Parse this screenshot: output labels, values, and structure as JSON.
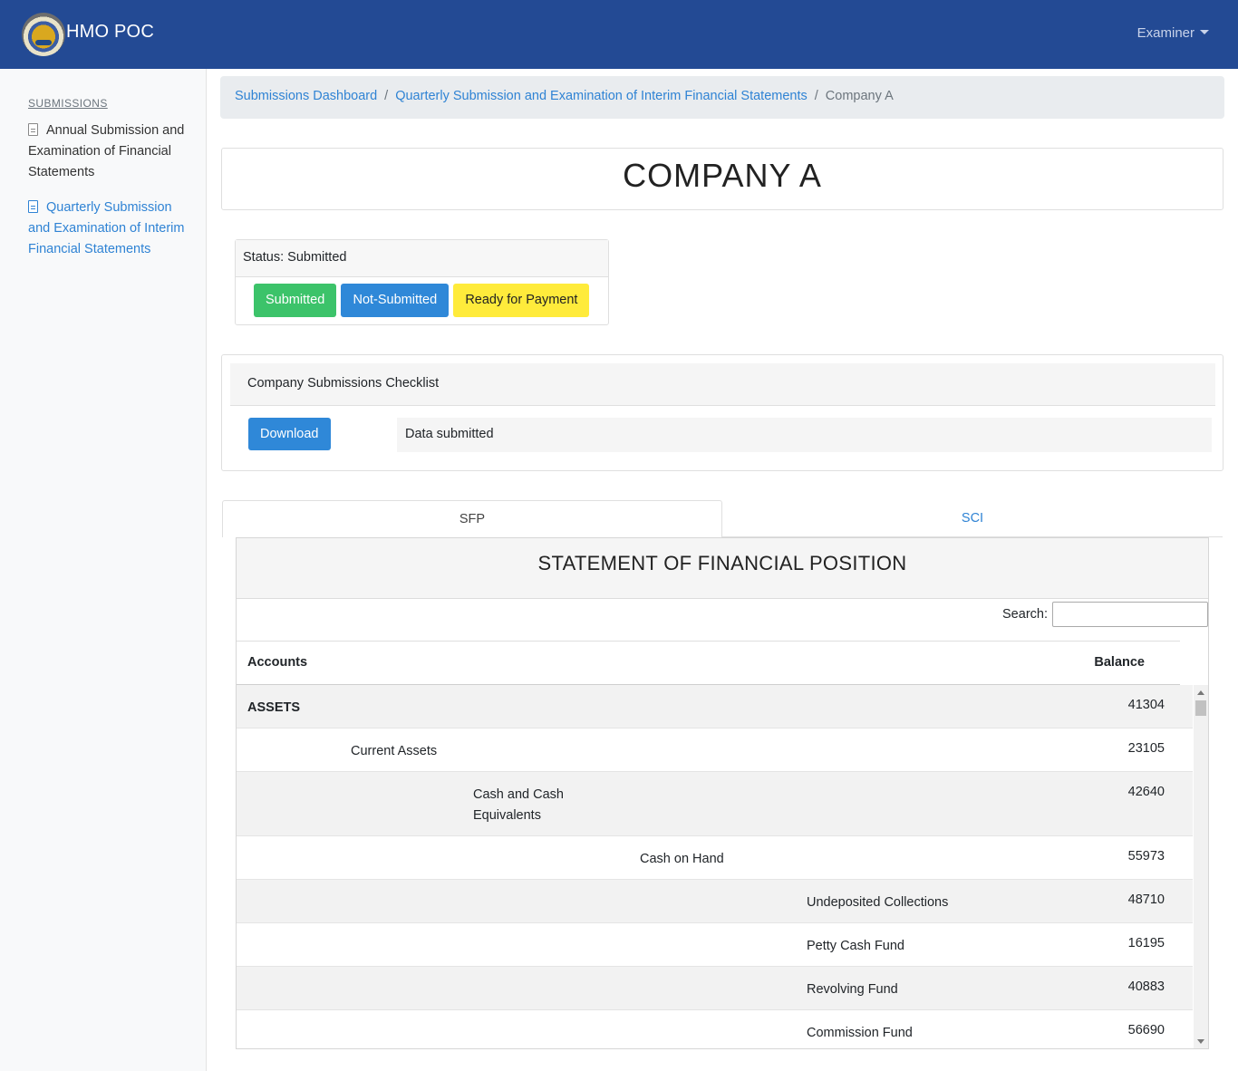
{
  "navbar": {
    "brand": "HMO POC",
    "user_menu": "Examiner"
  },
  "sidebar": {
    "heading": "SUBMISSIONS",
    "items": [
      {
        "label": "Annual Submission and Examination of Financial Statements"
      },
      {
        "label": "Quarterly Submission and Examination of Interim Financial Statements"
      }
    ]
  },
  "breadcrumb": {
    "items": [
      {
        "label": "Submissions Dashboard"
      },
      {
        "label": "Quarterly Submission and Examination of Interim Financial Statements"
      },
      {
        "label": "Company A"
      }
    ]
  },
  "page": {
    "title": "COMPANY A"
  },
  "status": {
    "label": "Status: Submitted",
    "buttons": {
      "submitted": "Submitted",
      "not_submitted": "Not-Submitted",
      "ready_for_payment": "Ready for Payment"
    }
  },
  "checklist": {
    "title": "Company Submissions Checklist",
    "download_label": "Download",
    "data_status": "Data submitted"
  },
  "tabs": [
    {
      "label": "SFP"
    },
    {
      "label": "SCI"
    }
  ],
  "statement": {
    "title": "STATEMENT OF FINANCIAL POSITION",
    "search_label": "Search:",
    "search_value": "",
    "columns": {
      "accounts": "Accounts",
      "balance": "Balance"
    },
    "rows": [
      {
        "account": "ASSETS",
        "balance": "41304"
      },
      {
        "account": "Current Assets",
        "balance": "23105"
      },
      {
        "account": "Cash and Cash Equivalents",
        "balance": "42640"
      },
      {
        "account": "Cash on Hand",
        "balance": "55973"
      },
      {
        "account": "Undeposited Collections",
        "balance": "48710"
      },
      {
        "account": "Petty Cash Fund",
        "balance": "16195"
      },
      {
        "account": "Revolving Fund",
        "balance": "40883"
      },
      {
        "account": "Commission Fund",
        "balance": "56690"
      }
    ]
  },
  "colors": {
    "navbar": "#234a94",
    "link": "#2f83d4",
    "green": "#3cc36a",
    "blue": "#2f88d8",
    "yellow": "#ffeb3b"
  }
}
